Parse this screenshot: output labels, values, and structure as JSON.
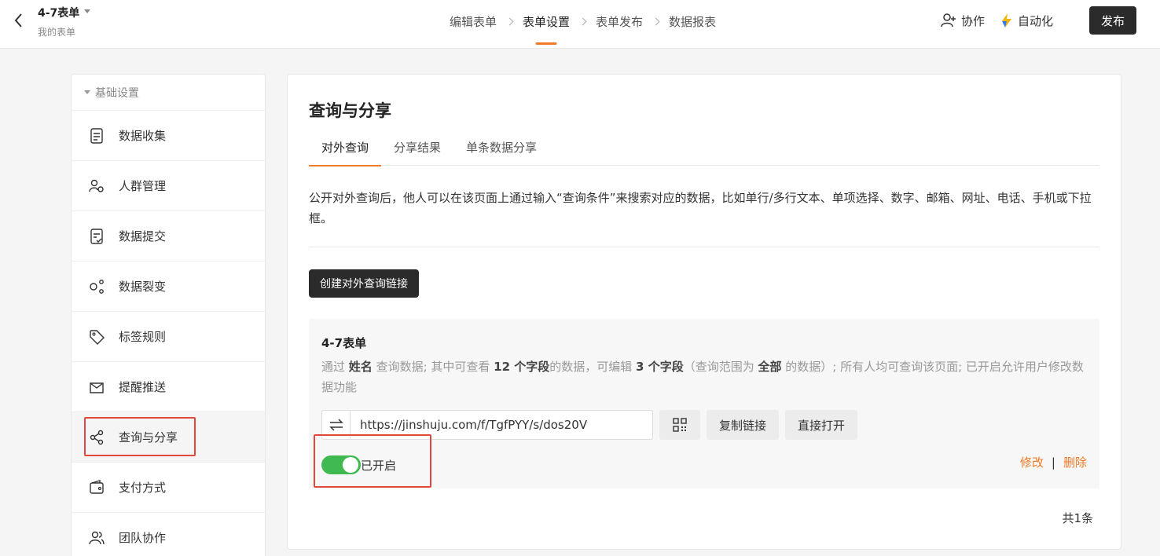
{
  "header": {
    "form_title": "4-7表单",
    "form_subtitle": "我的表单",
    "steps": [
      "编辑表单",
      "表单设置",
      "表单发布",
      "数据报表"
    ],
    "active_step": "表单设置",
    "collab_label": "协作",
    "automation_label": "自动化",
    "publish_label": "发布"
  },
  "sidebar": {
    "section_label": "基础设置",
    "items": [
      {
        "label": "数据收集",
        "icon": "document-icon"
      },
      {
        "label": "人群管理",
        "icon": "user-settings-icon"
      },
      {
        "label": "数据提交",
        "icon": "submit-doc-icon"
      },
      {
        "label": "数据裂变",
        "icon": "fission-icon"
      },
      {
        "label": "标签规则",
        "icon": "tag-icon"
      },
      {
        "label": "提醒推送",
        "icon": "push-icon"
      },
      {
        "label": "查询与分享",
        "icon": "share-icon",
        "active": true
      },
      {
        "label": "支付方式",
        "icon": "wallet-icon"
      },
      {
        "label": "团队协作",
        "icon": "team-icon"
      }
    ]
  },
  "main": {
    "title": "查询与分享",
    "tabs": [
      "对外查询",
      "分享结果",
      "单条数据分享"
    ],
    "description": "公开对外查询后，他人可以在该页面上通过输入“查询条件”来搜索对应的数据，比如单行/多行文本、单项选择、数字、邮箱、网址、电话、手机或下拉框。",
    "create_button": "创建对外查询链接",
    "card": {
      "title": "4-7表单",
      "desc_prefix": "通过 ",
      "desc_field": "姓名",
      "desc_mid1": " 查询数据; 其中可查看 ",
      "desc_view_count": "12 个字段",
      "desc_mid2": "的数据，可编辑 ",
      "desc_edit_count": "3 个字段",
      "desc_mid3": "（查询范围为 ",
      "desc_scope": "全部",
      "desc_suffix": " 的数据）; 所有人均可查询该页面; 已开启允许用户修改数据功能",
      "url": "https://jinshuju.com/f/TgfPYY/s/dos20V",
      "copy_label": "复制链接",
      "open_label": "直接打开",
      "toggle_label": "已开启",
      "toggle_on": true,
      "edit_label": "修改",
      "separator": "|",
      "delete_label": "删除"
    },
    "total": "共1条"
  },
  "colors": {
    "accent": "#f07a28",
    "toggle_on": "#3fb950",
    "dark_button": "#2b2b2b",
    "highlight": "#e2473c"
  }
}
